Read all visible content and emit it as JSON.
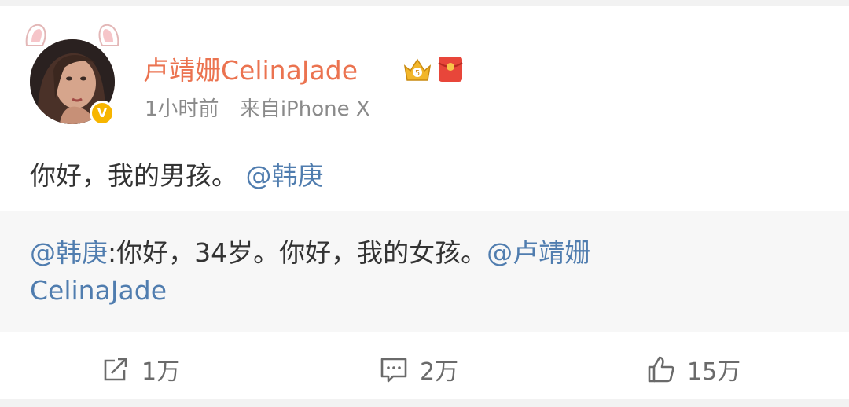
{
  "post": {
    "author": "卢靖姗CelinaJade",
    "time": "1小时前",
    "source": "来自iPhone X",
    "text_plain": "你好，我的男孩。",
    "text_mention": "@韩庚"
  },
  "repost": {
    "author_mention": "@韩庚",
    "text": ":你好，34岁。你好，我的女孩。",
    "mention_line1": "@卢靖姗",
    "mention_line2": "CelinaJade"
  },
  "actions": {
    "repost_count": "1万",
    "comment_count": "2万",
    "like_count": "15万"
  },
  "colors": {
    "username": "#eb7350",
    "mention": "#507daf",
    "meta": "#8a8a8a",
    "verified": "#f7b500"
  },
  "icons": [
    "bunny-ears-icon",
    "verified-badge-icon",
    "vip-crown-icon",
    "red-packet-icon",
    "repost-icon",
    "comment-icon",
    "like-icon"
  ]
}
